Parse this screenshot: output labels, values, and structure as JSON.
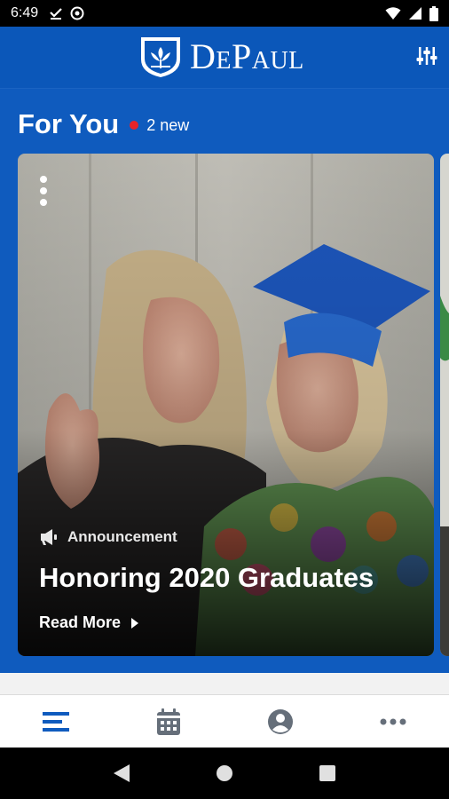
{
  "status_bar": {
    "time": "6:49",
    "left_icons": [
      "download-done-icon",
      "vpn-icon"
    ],
    "right_icons": [
      "wifi-icon",
      "signal-icon",
      "battery-icon"
    ]
  },
  "header": {
    "brand": "DePaul",
    "logo_icon": "depaul-shield-logo",
    "filter_icon": "tune-sliders-icon",
    "background": "#0b57b9"
  },
  "feed": {
    "title": "For You",
    "new_count": "2 new",
    "badge_color": "#e8232a"
  },
  "card": {
    "category": "Announcement",
    "category_icon": "megaphone-icon",
    "title": "Honoring 2020 Graduates",
    "action": "Read More",
    "menu_icon": "more-vertical-icon"
  },
  "tab_bar": {
    "tabs": [
      {
        "icon": "feed-list-icon",
        "selected": true
      },
      {
        "icon": "calendar-icon",
        "selected": false
      },
      {
        "icon": "account-icon",
        "selected": false
      },
      {
        "icon": "more-horizontal-icon",
        "selected": false
      }
    ],
    "active_color": "#0f5bbe",
    "inactive_color": "#666f7a"
  },
  "system_nav": {
    "buttons": [
      "back-icon",
      "home-icon",
      "recents-icon"
    ]
  }
}
